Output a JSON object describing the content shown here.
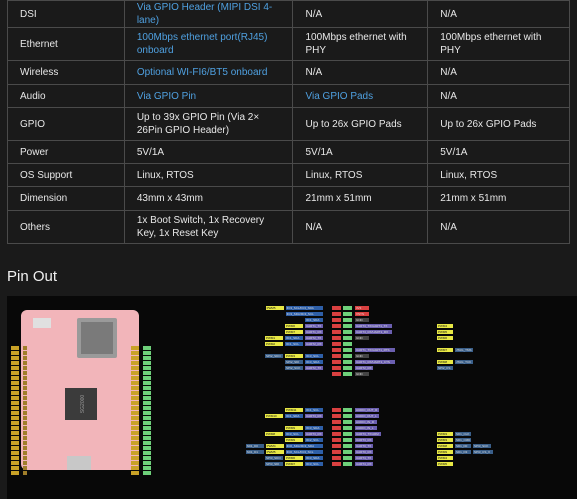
{
  "spec_table": {
    "rows": [
      {
        "name": "DSI",
        "c1": "Via GPIO Header (MIPI DSI 4-lane)",
        "c1_link": true,
        "c2": "N/A",
        "c2_link": false,
        "c3": "N/A"
      },
      {
        "name": "Ethernet",
        "c1": "100Mbps ethernet port(RJ45) onboard",
        "c1_link": true,
        "c2": "100Mbps ethernet with PHY",
        "c2_link": false,
        "c3": "100Mbps ethernet with PHY"
      },
      {
        "name": "Wireless",
        "c1": "Optional WI-FI6/BT5 onboard",
        "c1_link": true,
        "c2": "N/A",
        "c2_link": false,
        "c3": "N/A"
      },
      {
        "name": "Audio",
        "c1": "Via GPIO Pin",
        "c1_link": true,
        "c2": "Via GPIO Pads",
        "c2_link": true,
        "c3": "N/A"
      },
      {
        "name": "GPIO",
        "c1": "Up to 39x GPIO Pin (Via 2× 26Pin GPIO Header)",
        "c1_link": false,
        "c2": "Up to 26x GPIO Pads",
        "c2_link": false,
        "c3": "Up to 26x GPIO Pads"
      },
      {
        "name": "Power",
        "c1": "5V/1A",
        "c1_link": false,
        "c2": "5V/1A",
        "c2_link": false,
        "c3": "5V/1A"
      },
      {
        "name": "OS Support",
        "c1": "Linux, RTOS",
        "c1_link": false,
        "c2": "Linux, RTOS",
        "c2_link": false,
        "c3": "Linux, RTOS"
      },
      {
        "name": "Dimension",
        "c1": "43mm x 43mm",
        "c1_link": false,
        "c2": "21mm x 51mm",
        "c2_link": false,
        "c3": "21mm x 51mm"
      },
      {
        "name": "Others",
        "c1": "1x Boot Switch, 1x Recovery Key, 1x Reset Key",
        "c1_link": false,
        "c2": "N/A",
        "c2_link": false,
        "c3": "N/A"
      }
    ]
  },
  "section_title": "Pin Out",
  "pinout": {
    "chip_label": "SG2000",
    "colors": {
      "pwm": "#e8e845",
      "i2c": "#2e5fa8",
      "uart": "#6b5fb0",
      "gpio": "#6ed07a",
      "pin": "#d94040",
      "spi": "#3a5f8a",
      "board": "#f2b5ba"
    },
    "upper_rows": [
      {
        "l": [
          "PWM5",
          "IIC3_SCL/IIC3_SDA"
        ],
        "r": [
          "3V3"
        ],
        "rr": []
      },
      {
        "l": [
          "IIC3_SDA/IIC3_SCL"
        ],
        "r": [
          "VSYS"
        ],
        "rr": []
      },
      {
        "l": [
          "IIC1_SDA"
        ],
        "r": [
          "GND"
        ],
        "rr": []
      },
      {
        "l": [
          "PWM6",
          "UART1_TX"
        ],
        "r": [
          "UART3_TX/UART1_TX"
        ],
        "rr": [
          "PWM4"
        ]
      },
      {
        "l": [
          "PWM7",
          "UART1_RX"
        ],
        "r": [
          "UART3_RX/UART1_RX"
        ],
        "rr": [
          "PWM5"
        ]
      },
      {
        "l": [
          "PWM1",
          "IIC1_SDA",
          "UART2_TX"
        ],
        "r": [
          "GND"
        ],
        "rr": [
          "PWM6"
        ]
      },
      {
        "l": [
          "PWM2",
          "IIC1_SCL",
          "UART2_RX"
        ],
        "r": [],
        "rr": []
      },
      {
        "l": [],
        "r": [
          "UART1_TX/UART1_RTS"
        ],
        "rr": [
          "PWM7",
          "JTAG_TMS"
        ]
      },
      {
        "l": [
          "SPI2_SDO",
          "PWM3",
          "IIC3_SCL"
        ],
        "r": [
          "GND"
        ],
        "rr": []
      },
      {
        "l": [
          "SPI2_SDI",
          "IIC3_SDA"
        ],
        "r": [
          "UART1_RX/UART1_CTS"
        ],
        "rr": [
          "PWM8",
          "JTAG_TCK"
        ]
      },
      {
        "l": [
          "SPI2_SCK",
          "UART2_TX"
        ],
        "r": [
          "UART2_RX"
        ],
        "rr": [
          "SPI2_CS"
        ]
      },
      {
        "l": [],
        "r": [
          "GND"
        ],
        "rr": []
      }
    ],
    "lower_rows": [
      {
        "l": [
          "PWM11",
          "IIC1_SCL"
        ],
        "r": [
          "AUDIO_OUT_R"
        ],
        "rr": []
      },
      {
        "l": [
          "PWM10",
          "IIC1_SDA",
          "UART3_RX"
        ],
        "r": [
          "AUDIO_OUT_L"
        ],
        "rr": []
      },
      {
        "l": [],
        "r": [
          "AUDIO_IN_R"
        ],
        "rr": []
      },
      {
        "l": [
          "PWM9",
          "IIC3_SDA"
        ],
        "r": [
          "AUDIO_IN_L"
        ],
        "rr": []
      },
      {
        "l": [
          "PWM8",
          "IIC3_SCL",
          "UART3_RX"
        ],
        "r": [
          "UART3_TX/ARM"
        ],
        "rr": [
          "PWM3",
          "SD1_CLK"
        ]
      },
      {
        "l": [
          "PWM9",
          "IIC2_SCL"
        ],
        "r": [
          "UART3_RX"
        ],
        "rr": [
          "PWM3",
          "SD1_CMD"
        ]
      },
      {
        "l": [
          "SD1_D0",
          "PWM4",
          "IIC0_SDA/IIC3_SDA"
        ],
        "r": [
          "UART0_TX"
        ],
        "rr": [
          "PWM8",
          "SD1_D0",
          "SPI3_SCK"
        ]
      },
      {
        "l": [
          "SD1_D1",
          "PWM5",
          "IIC0_SCL/IIC3_SCL"
        ],
        "r": [
          "UART0_RX"
        ],
        "rr": [
          "PWM9",
          "SD1_D3",
          "SPI3_CS_X"
        ]
      },
      {
        "l": [
          "SPI3_SDO",
          "PWM6",
          "IIC3_SDA"
        ],
        "r": [
          "UART4_TX"
        ],
        "rr": [
          "PWM4"
        ]
      },
      {
        "l": [
          "SPI3_SDI",
          "PWM7",
          "IIC3_SCL"
        ],
        "r": [
          "UART4_RX"
        ],
        "rr": [
          "PWM5"
        ]
      }
    ]
  }
}
